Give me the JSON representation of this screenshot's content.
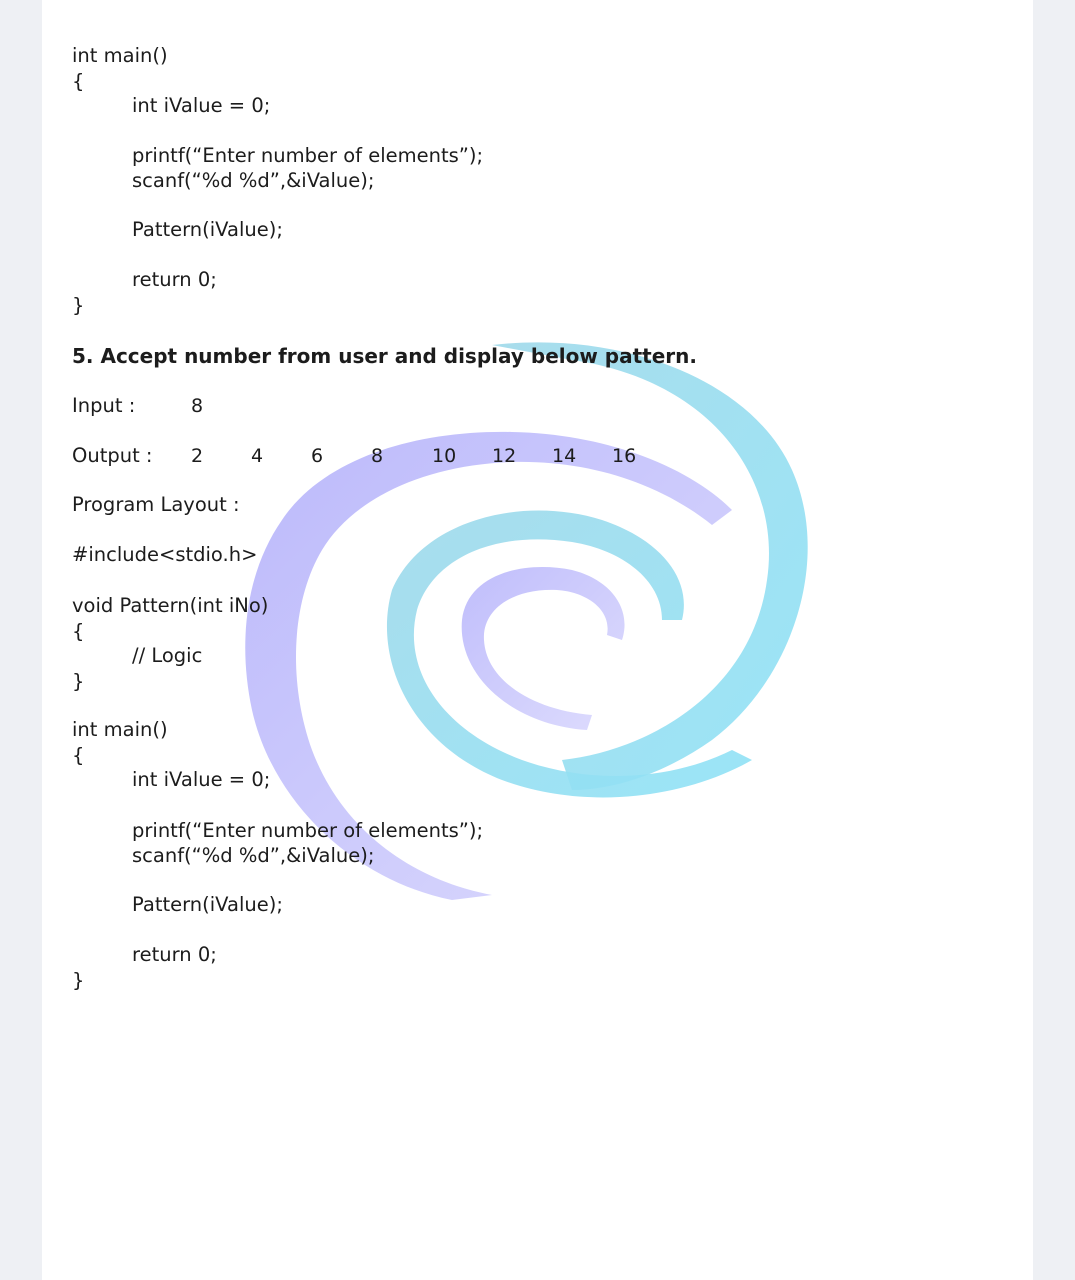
{
  "code_top": {
    "main_sig": "int main()",
    "open_brace": "{",
    "ivalue_decl": "int iValue = 0;",
    "printf_line": "printf(“Enter number of elements”);",
    "scanf_line": "scanf(“%d %d”,&iValue);",
    "pattern_call": "Pattern(iValue);",
    "return_line": "return 0;",
    "close_brace": "}"
  },
  "question": {
    "title": "5. Accept number from user and display below pattern.",
    "input_label": "Input :",
    "input_value": "8",
    "output_label": "Output :",
    "output_values": [
      "2",
      "4",
      "6",
      "8",
      "10",
      "12",
      "14",
      "16"
    ],
    "layout_label": "Program Layout :"
  },
  "code_bottom": {
    "include_line": "#include<stdio.h>",
    "pattern_sig": "void Pattern(int iNo)",
    "open_brace_1": "{",
    "logic_comment": "// Logic",
    "close_brace_1": "}",
    "main_sig": "int main()",
    "open_brace_2": "{",
    "ivalue_decl": "int iValue = 0;",
    "printf_line": "printf(“Enter number of elements”);",
    "scanf_line": "scanf(“%d %d”,&iValue);",
    "pattern_call": "Pattern(iValue);",
    "return_line": "return 0;",
    "close_brace_2": "}"
  },
  "colors": {
    "swirl_purple": "#b9b6fb",
    "swirl_cyan": "#8fdff3",
    "page": "#ffffff",
    "background": "#eef0f4"
  }
}
